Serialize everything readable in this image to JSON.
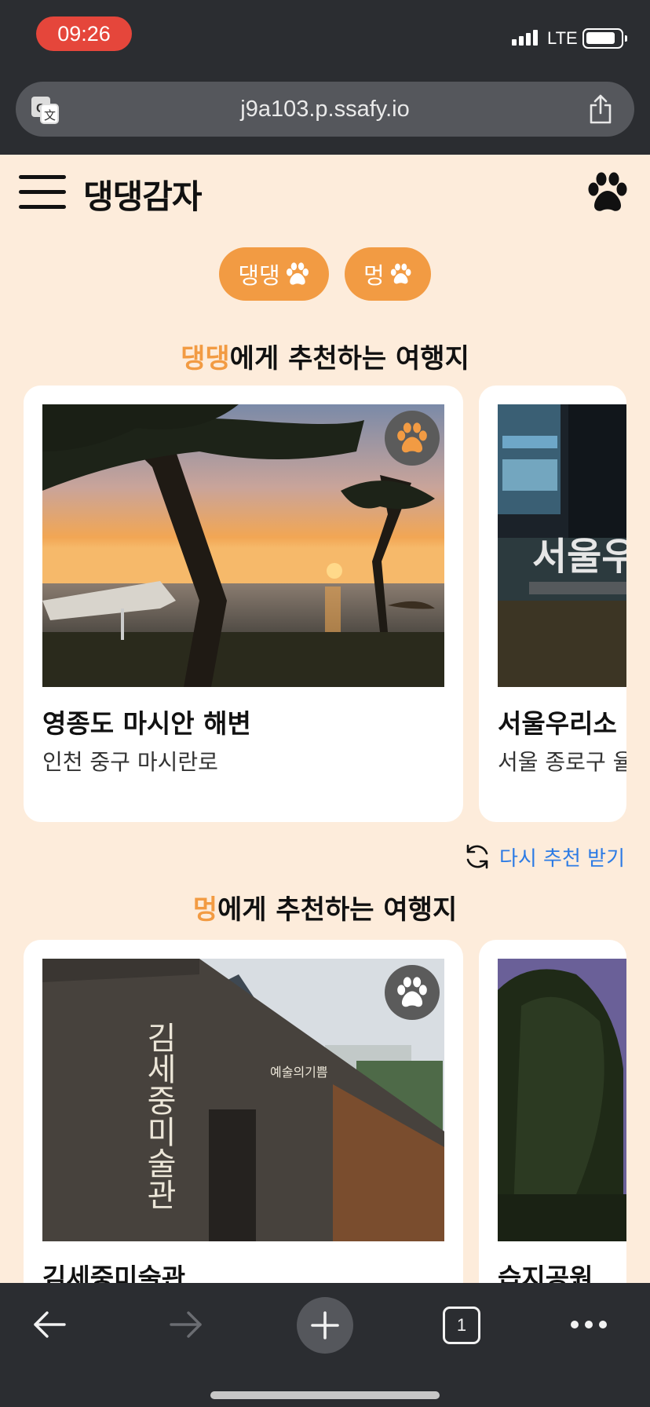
{
  "status": {
    "time": "09:26",
    "network": "LTE"
  },
  "browser": {
    "url": "j9a103.p.ssafy.io",
    "tabs_count": "1"
  },
  "app": {
    "logo": "댕댕감자"
  },
  "chips": [
    {
      "label": "댕댕"
    },
    {
      "label": "멍"
    }
  ],
  "sections": [
    {
      "title_highlight": "댕댕",
      "title_rest": "에게 추천하는 여행지",
      "cards": [
        {
          "title": "영종도 마시안 해변",
          "address": "인천 중구 마시란로"
        },
        {
          "title": "서울우리소",
          "address": "서울 종로구 율"
        }
      ]
    },
    {
      "title_highlight": "멍",
      "title_rest": "에게 추천하는 여행지",
      "cards": [
        {
          "title": "김세중미술관",
          "address": ""
        },
        {
          "title": "습지공원",
          "address": ""
        }
      ]
    }
  ],
  "reload_label": "다시 추천 받기",
  "image_text": {
    "museum_sign": "김세중미술관",
    "museum_sub": "예술의기쁨",
    "seoul_sign": "서울우"
  },
  "colors": {
    "accent": "#f29b43",
    "page_bg": "#fdecdb",
    "link": "#2c7be5"
  },
  "icons": [
    "translate-icon",
    "share-icon",
    "menu-icon",
    "paw-icon",
    "refresh-icon",
    "back-icon",
    "forward-icon",
    "new-tab-icon",
    "tabs-icon",
    "more-icon"
  ]
}
